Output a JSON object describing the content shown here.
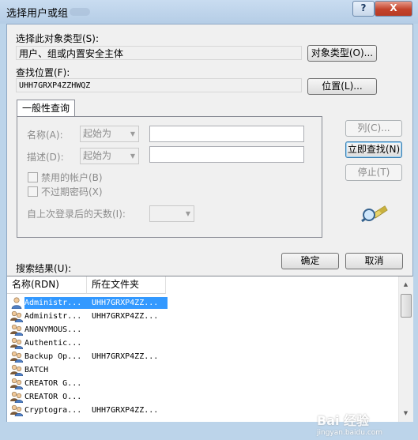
{
  "window": {
    "title": "选择用户或组",
    "help_label": "?",
    "close_label": "X"
  },
  "object_type": {
    "label": "选择此对象类型(S):",
    "value": "用户、组或内置安全主体",
    "button": "对象类型(O)..."
  },
  "location": {
    "label": "查找位置(F):",
    "value": "UHH7GRXP4ZZHWQZ",
    "button": "位置(L)..."
  },
  "common_query": {
    "tab_label": "一般性查询",
    "name_label": "名称(A):",
    "name_mode": "起始为",
    "name_value": "",
    "desc_label": "描述(D):",
    "desc_mode": "起始为",
    "desc_value": "",
    "disabled_accounts": "禁用的帐户(B)",
    "non_expiring_pw": "不过期密码(X)",
    "days_since_logon_label": "自上次登录后的天数(I):",
    "days_since_logon_value": ""
  },
  "side_buttons": {
    "columns": "列(C)...",
    "find_now": "立即查找(N)",
    "stop": "停止(T)"
  },
  "results": {
    "label": "搜索结果(U):",
    "ok": "确定",
    "cancel": "取消",
    "columns": [
      "名称(RDN)",
      "所在文件夹"
    ],
    "rows": [
      {
        "name": "Administr...",
        "folder": "UHH7GRXP4ZZ...",
        "icon": "user-icon"
      },
      {
        "name": "Administr...",
        "folder": "UHH7GRXP4ZZ...",
        "icon": "group-icon"
      },
      {
        "name": "ANONYMOUS...",
        "folder": "",
        "icon": "group-icon"
      },
      {
        "name": "Authentic...",
        "folder": "",
        "icon": "group-icon"
      },
      {
        "name": "Backup Op...",
        "folder": "UHH7GRXP4ZZ...",
        "icon": "group-icon"
      },
      {
        "name": "BATCH",
        "folder": "",
        "icon": "group-icon"
      },
      {
        "name": "CREATOR G...",
        "folder": "",
        "icon": "group-icon"
      },
      {
        "name": "CREATOR O...",
        "folder": "",
        "icon": "group-icon"
      },
      {
        "name": "Cryptogra...",
        "folder": "UHH7GRXP4ZZ...",
        "icon": "group-icon"
      }
    ]
  },
  "watermark": {
    "main": "Bai 经验",
    "sub": "jingyan.baidu.com"
  },
  "colors": {
    "selection": "#3399ff",
    "title_bar": "#bcd4ea"
  }
}
